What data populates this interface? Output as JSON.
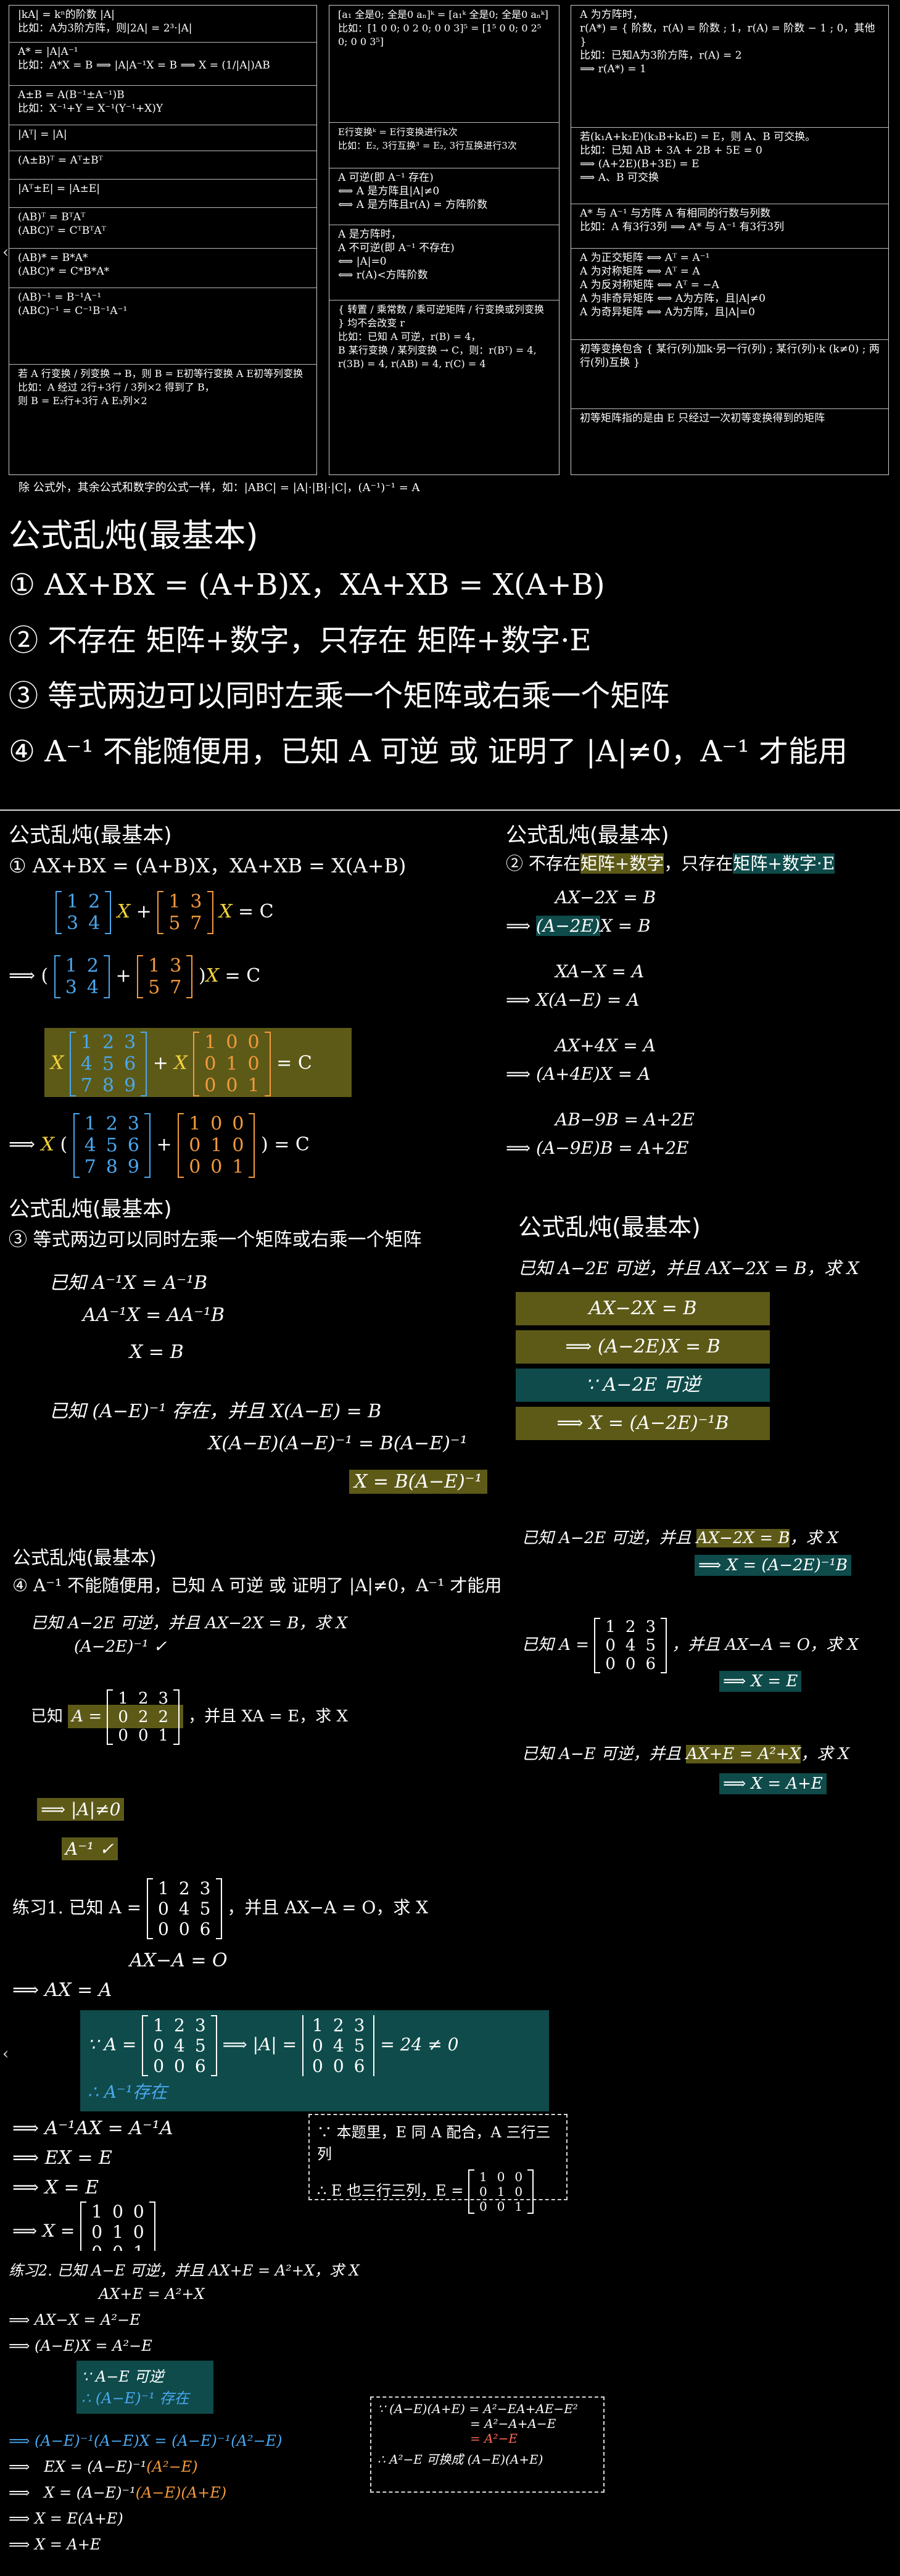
{
  "top_panel": {
    "col1": [
      "|kA| = kⁿ的阶数 |A|\n比如：A为3阶方阵，则|2A| = 2³·|A|",
      "A* = |A|A⁻¹\n比如：A*X = B ⟹ |A|A⁻¹X = B ⟹ X = (1/|A|)AB",
      "A±B = A(B⁻¹±A⁻¹)B\n比如：X⁻¹+Y = X⁻¹(Y⁻¹+X)Y",
      "|Aᵀ| = |A|",
      "(A±B)ᵀ = Aᵀ±Bᵀ",
      "|Aᵀ±E| = |A±E|",
      "(AB)ᵀ = BᵀAᵀ\n(ABC)ᵀ = CᵀBᵀAᵀ",
      "(AB)* = B*A*\n(ABC)* = C*B*A*",
      "(AB)⁻¹ = B⁻¹A⁻¹\n(ABC)⁻¹ = C⁻¹B⁻¹A⁻¹",
      "若 A  行变换 / 列变换  → B，则 B = E初等行变换 A E初等列变换\n比如：A 经过 2行+3行 / 3列×2 得到了 B，\n则 B = E₂行+3行 A E₃列×2"
    ],
    "col2": [
      "[a₁ 全是0; 全是0 aₙ]ᵏ = [a₁ᵏ 全是0; 全是0 aₙᵏ]\n比如：[1 0 0; 0 2 0; 0 0 3]⁵ = [1⁵ 0 0; 0 2⁵ 0; 0 0 3⁵]",
      "E行变换ᵏ = E行变换进行k次\n比如：E₂, 3行互换³ = E₂, 3行互换进行3次",
      "A 可逆(即 A⁻¹ 存在)\n⟺ A 是方阵且|A|≠0\n⟺ A 是方阵且r(A) = 方阵阶数",
      "A 是方阵时，\nA 不可逆(即 A⁻¹ 不存在)\n⟺ |A|=0\n⟺ r(A)<方阵阶数",
      "{ 转置 / 乘常数 / 乘可逆矩阵 / 行变换或列变换 } 均不会改变 r\n比如：已知 A 可逆，r(B) = 4，\nB  某行变换 / 某列变换 → C，则：r(Bᵀ) = 4, r(3B) = 4, r(AB) = 4, r(C) = 4"
    ],
    "col3": [
      "A 为方阵时，\nr(A*) = { 阶数，r(A) = 阶数 ; 1，r(A) = 阶数 − 1 ; 0，其他 }\n比如：已知A为3阶方阵，r(A) = 2\n⟹ r(A*) = 1",
      "若(k₁A+k₂E)(k₃B+k₄E) = E，则 A、B 可交换。\n比如：已知 AB + 3A + 2B + 5E = 0\n⟹ (A+2E)(B+3E) = E\n⟹ A、B 可交换",
      "A* 与 A⁻¹ 与方阵 A 有相同的行数与列数\n比如：A 有3行3列 ⟹ A* 与 A⁻¹ 有3行3列",
      "A 为正交矩阵 ⟺ Aᵀ = A⁻¹\nA 为对称矩阵 ⟺ Aᵀ = A\nA 为反对称矩阵 ⟺ Aᵀ = −A\nA 为非奇异矩阵 ⟺ A为方阵，且|A|≠0\nA 为奇异矩阵 ⟺ A为方阵，且|A|=0",
      "初等变换包含 { 某行(列)加k·另一行(列) ; 某行(列)·k (k≠0) ; 两行(列)互换 }",
      "初等矩阵指的是由 E 只经过一次初等变换得到的矩阵"
    ],
    "footer": "除  公式外，其余公式和数字的公式一样，如：|ABC| = |A|·|B|·|C|，(A⁻¹)⁻¹ = A"
  },
  "section1": {
    "title": "公式乱炖(最基本)",
    "items": [
      "① AX+BX = (A+B)X，XA+XB = X(A+B)",
      "② 不存在 矩阵+数字，只存在 矩阵+数字·E",
      "③ 等式两边可以同时左乘一个矩阵或右乘一个矩阵",
      "④ A⁻¹ 不能随便用，已知 A 可逆 或 证明了 |A|≠0，A⁻¹ 才能用"
    ]
  },
  "section2": {
    "left_title": "公式乱炖(最基本)",
    "left_rule": "① AX+BX = (A+B)X，XA+XB = X(A+B)",
    "right_title": "公式乱炖(最基本)",
    "right_rule_pre": "② 不存在",
    "right_rule_hl1": "矩阵+数字",
    "right_rule_mid": "，只存在",
    "right_rule_hl2": "矩阵+数字·E",
    "right_lines": [
      "AX−2X = B",
      "⟹ (A−2E)X = B",
      "XA−X = A",
      "⟹ X(A−E) = A",
      "AX+4X = A",
      "⟹ (A+4E)X = A",
      "AB−9B = A+2E",
      "⟹ (A−9E)B = A+2E"
    ],
    "m1": [
      "1",
      "2",
      "3",
      "4"
    ],
    "m2": [
      "1",
      "3",
      "5",
      "7"
    ],
    "m3": [
      "1",
      "2",
      "3",
      "4",
      "5",
      "6",
      "7",
      "8",
      "9"
    ],
    "m4": [
      "1",
      "0",
      "0",
      "0",
      "1",
      "0",
      "0",
      "0",
      "1"
    ],
    "eq_c": "= C"
  },
  "section3": {
    "title": "公式乱炖(最基本)",
    "rule": "③ 等式两边可以同时左乘一个矩阵或右乘一个矩阵",
    "lines": [
      "已知 A⁻¹X = A⁻¹B",
      "AA⁻¹X = AA⁻¹B",
      "X = B",
      "已知 (A−E)⁻¹ 存在，并且 X(A−E) = B",
      "X(A−E)(A−E)⁻¹ = B(A−E)⁻¹",
      "X = B(A−E)⁻¹"
    ],
    "right_title": "公式乱炖(最基本)",
    "right_q": "已知 A−2E 可逆，并且 AX−2X = B，求 X",
    "right_steps": [
      "AX−2X = B",
      "⟹   (A−2E)X = B",
      "∵ A−2E 可逆",
      "⟹   X = (A−2E)⁻¹B"
    ]
  },
  "section4": {
    "title": "公式乱炖(最基本)",
    "rule": "④ A⁻¹ 不能随便用，已知 A 可逆 或 证明了 |A|≠0，A⁻¹ 才能用",
    "q1": "已知 A−2E 可逆，并且 AX−2X = B，求 X",
    "q1_inv": "(A−2E)⁻¹ ✓",
    "q2_pre": "已知",
    "q2_post": "，并且 XA = E，求 X",
    "q2_m": [
      "1",
      "2",
      "3",
      "0",
      "2",
      "2",
      "0",
      "0",
      "1"
    ],
    "q2_step1": "⟹ |A|≠0",
    "q2_step2": "A⁻¹ ✓",
    "r1_q": "已知 A−2E 可逆，并且 AX−2X = B，求 X",
    "r1_a": "⟹ X = (A−2E)⁻¹B",
    "r2_pre": "已知 A =",
    "r2_post": "，并且 AX−A = O，求 X",
    "r2_m": [
      "1",
      "2",
      "3",
      "0",
      "4",
      "5",
      "0",
      "0",
      "6"
    ],
    "r2_a": "⟹ X = E",
    "r3_q": "已知 A−E 可逆，并且 AX+E = A²+X，求 X",
    "r3_a": "⟹ X = A+E"
  },
  "ex1": {
    "title": "练习1. 已知 A =",
    "title_post": "，并且 AX−A = O，求 X",
    "m": [
      "1",
      "2",
      "3",
      "0",
      "4",
      "5",
      "0",
      "0",
      "6"
    ],
    "steps": [
      "AX−A = O",
      "⟹   AX = A",
      "∵ A =",
      "⟹ |A| =",
      "= 24 ≠ 0",
      "∴ A⁻¹存在",
      "⟹   A⁻¹AX = A⁻¹A",
      "⟹   EX = E",
      "⟹   X = E",
      "⟹   X ="
    ],
    "note1": "∵ 本题里，E 同 A 配合，A 三行三列",
    "note2": "∴ E 也三行三列，E =",
    "e": [
      "1",
      "0",
      "0",
      "0",
      "1",
      "0",
      "0",
      "0",
      "1"
    ]
  },
  "ex2": {
    "title": "练习2. 已知 A−E 可逆，并且 AX+E = A²+X，求 X",
    "steps": [
      "AX+E = A²+X",
      "⟹   AX−X = A²−E",
      "⟹   (A−E)X = A²−E",
      "∵ A−E 可逆",
      "∴ (A−E)⁻¹ 存在",
      "⟹ (A−E)⁻¹(A−E)X = (A−E)⁻¹(A²−E)",
      "⟹   EX = (A−E)⁻¹(A²−E)",
      "⟹   X = (A−E)⁻¹(A−E)(A+E)",
      "⟹   X = E(A+E)",
      "⟹   X = A+E"
    ],
    "note1": "∵ (A−E)(A+E) = A²−EA+AE−E²",
    "note2": "= A²−A+A−E",
    "note3": "= A²−E",
    "note4": "∴ A²−E 可换成 (A−E)(A+E)"
  },
  "colors": {
    "yellow_hl": "#5d5a18",
    "teal_hl": "#0f4b4b",
    "orange": "#f39a3c",
    "blue": "#4aa8ef",
    "gold": "#f2d33b"
  }
}
